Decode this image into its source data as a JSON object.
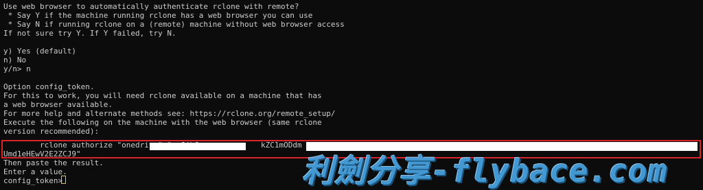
{
  "terminal": {
    "lines": [
      "Use web browser to automatically authenticate rclone with remote?",
      " * Say Y if the machine running rclone has a web browser you can use",
      " * Say N if running rclone on a (remote) machine without web browser access",
      "If not sure try Y. If Y failed, try N.",
      "",
      "y) Yes (default)",
      "n) No",
      "y/n> n",
      "",
      "Option config_token.",
      "For this to work, you will need rclone available on a machine that has",
      "a web browser available.",
      "For more help and alternate methods see: https://rclone.org/remote_setup/",
      "Execute the following on the machine with the web browser (same rclone",
      "version recommended):",
      "        rclone authorize \"onedrive\" \"eyJjbG",
      "Umd1eHEwV2E2ZCJ9\"",
      "Then paste the result.",
      "Enter a value.",
      "config_token> "
    ],
    "partial_tokens": [
      "kZC1mODdm"
    ],
    "watermark": "利劍分享-flybace.com"
  },
  "colors": {
    "background": "#0c0c0c",
    "text": "#cccccc",
    "highlight_border": "#d9242c",
    "cursor": "#e5c07b",
    "watermark": "#4aa8e8"
  }
}
